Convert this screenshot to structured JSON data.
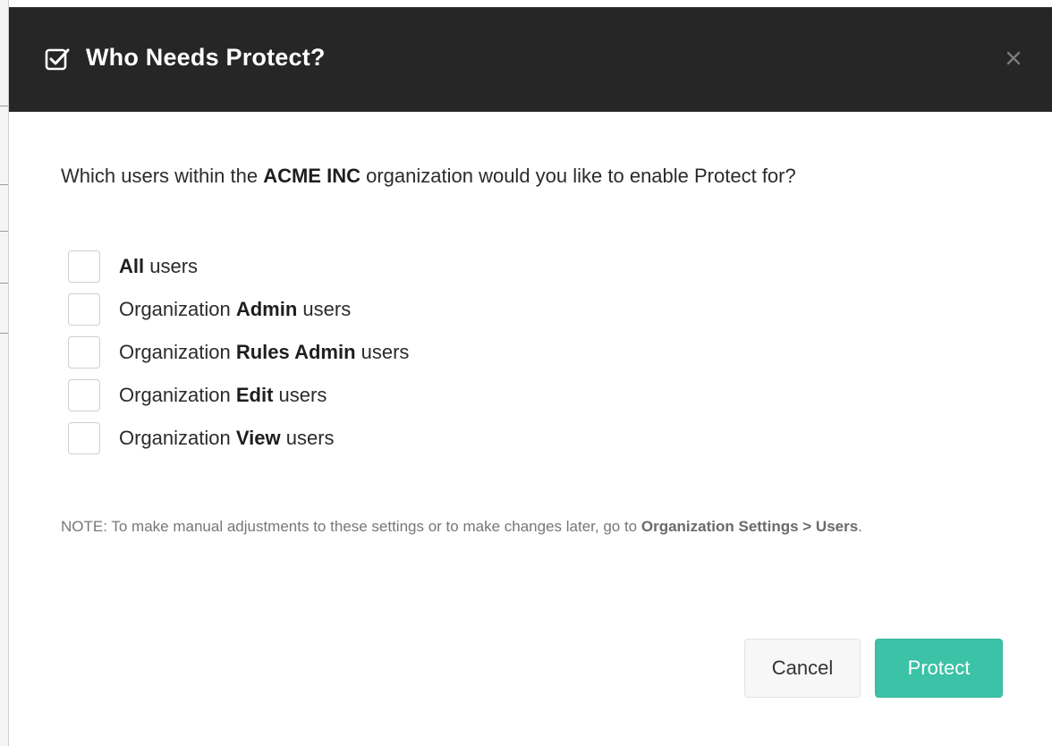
{
  "dialog": {
    "title": "Who Needs Protect?",
    "title_icon": "checkbox-check-icon",
    "close_icon": "close-icon"
  },
  "question": {
    "prefix": "Which users within the ",
    "org_name": "ACME INC",
    "suffix": " organization would you like to enable Protect for?"
  },
  "options": [
    {
      "prefix": "",
      "role": "All",
      "suffix": " users",
      "checked": false
    },
    {
      "prefix": "Organization ",
      "role": "Admin",
      "suffix": " users",
      "checked": false
    },
    {
      "prefix": "Organization ",
      "role": "Rules Admin",
      "suffix": " users",
      "checked": false
    },
    {
      "prefix": "Organization ",
      "role": "Edit",
      "suffix": " users",
      "checked": false
    },
    {
      "prefix": "Organization ",
      "role": "View",
      "suffix": " users",
      "checked": false
    }
  ],
  "note": {
    "text": "NOTE: To make manual adjustments to these settings or to make changes later, go to ",
    "link": "Organization Settings > Users",
    "end": "."
  },
  "buttons": {
    "cancel": "Cancel",
    "protect": "Protect"
  },
  "colors": {
    "header_bg": "#262626",
    "primary": "#3cc2a6"
  }
}
